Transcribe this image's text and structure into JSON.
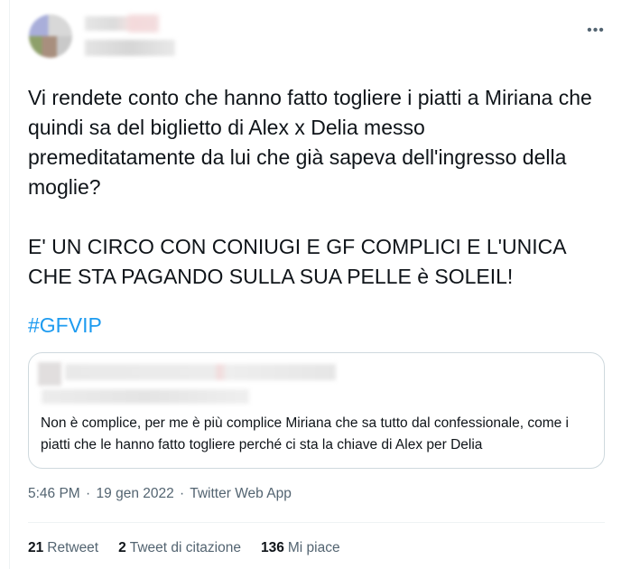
{
  "tweet": {
    "text": "Vi rendete conto che hanno fatto togliere i piatti a Miriana che quindi sa del biglietto di Alex x Delia messo premeditatamente da lui che già sapeva dell'ingresso della moglie?\n\nE' UN CIRCO CON CONIUGI E GF COMPLICI E L'UNICA CHE STA PAGANDO SULLA SUA PELLE è SOLEIL!",
    "hashtag": "#GFVIP",
    "more_icon": "more-horizontal-icon"
  },
  "quote": {
    "text": "Non è complice, per me è più complice Miriana che sa tutto dal confessionale, come i piatti che le hanno fatto togliere perché ci sta la chiave di Alex per Delia"
  },
  "meta": {
    "time": "5:46 PM",
    "sep1": "·",
    "date": "19 gen 2022",
    "sep2": "·",
    "source": "Twitter Web App"
  },
  "stats": {
    "retweets": {
      "count": "21",
      "label": "Retweet"
    },
    "quotes": {
      "count": "2",
      "label": "Tweet di citazione"
    },
    "likes": {
      "count": "136",
      "label": "Mi piace"
    }
  },
  "colors": {
    "link": "#1d9bf0",
    "secondary": "#536471",
    "border": "#cfd9de"
  }
}
